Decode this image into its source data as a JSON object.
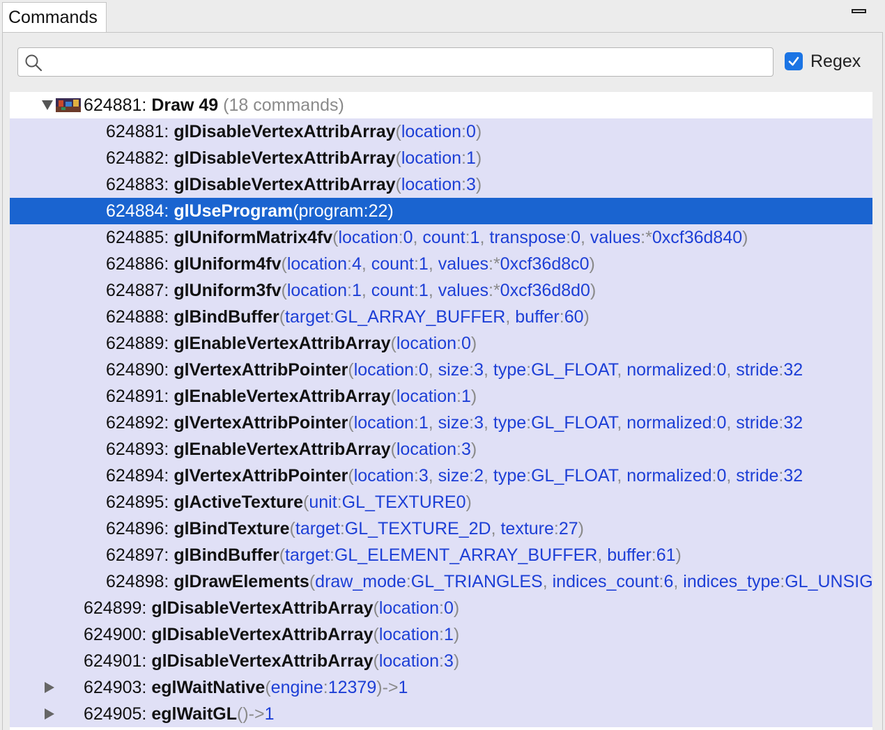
{
  "tab": {
    "title": "Commands"
  },
  "search": {
    "value": "",
    "placeholder": ""
  },
  "regex": {
    "label": "Regex",
    "checked": true
  },
  "group": {
    "id": "624881:",
    "title": "Draw 49",
    "count_text": "(18 commands)",
    "thumbnail_icon": "framebuffer-thumbnail-icon"
  },
  "commands": [
    {
      "id": "624881:",
      "fn": "glDisableVertexAttribArray",
      "params": [
        [
          "location",
          "0"
        ]
      ],
      "indent": "inner"
    },
    {
      "id": "624882:",
      "fn": "glDisableVertexAttribArray",
      "params": [
        [
          "location",
          "1"
        ]
      ],
      "indent": "inner"
    },
    {
      "id": "624883:",
      "fn": "glDisableVertexAttribArray",
      "params": [
        [
          "location",
          "3"
        ]
      ],
      "indent": "inner"
    },
    {
      "id": "624884:",
      "fn": "glUseProgram",
      "params": [
        [
          "program",
          "22"
        ]
      ],
      "indent": "inner",
      "selected": true
    },
    {
      "id": "624885:",
      "fn": "glUniformMatrix4fv",
      "params": [
        [
          "location",
          "0"
        ],
        [
          "count",
          "1"
        ],
        [
          "transpose",
          "0"
        ],
        [
          "values",
          "*0xcf36d840"
        ]
      ],
      "indent": "inner"
    },
    {
      "id": "624886:",
      "fn": "glUniform4fv",
      "params": [
        [
          "location",
          "4"
        ],
        [
          "count",
          "1"
        ],
        [
          "values",
          "*0xcf36d8c0"
        ]
      ],
      "indent": "inner"
    },
    {
      "id": "624887:",
      "fn": "glUniform3fv",
      "params": [
        [
          "location",
          "1"
        ],
        [
          "count",
          "1"
        ],
        [
          "values",
          "*0xcf36d8d0"
        ]
      ],
      "indent": "inner"
    },
    {
      "id": "624888:",
      "fn": "glBindBuffer",
      "params": [
        [
          "target",
          "GL_ARRAY_BUFFER"
        ],
        [
          "buffer",
          "60"
        ]
      ],
      "indent": "inner"
    },
    {
      "id": "624889:",
      "fn": "glEnableVertexAttribArray",
      "params": [
        [
          "location",
          "0"
        ]
      ],
      "indent": "inner"
    },
    {
      "id": "624890:",
      "fn": "glVertexAttribPointer",
      "params": [
        [
          "location",
          "0"
        ],
        [
          "size",
          "3"
        ],
        [
          "type",
          "GL_FLOAT"
        ],
        [
          "normalized",
          "0"
        ],
        [
          "stride",
          "32"
        ]
      ],
      "indent": "inner",
      "truncated": true
    },
    {
      "id": "624891:",
      "fn": "glEnableVertexAttribArray",
      "params": [
        [
          "location",
          "1"
        ]
      ],
      "indent": "inner"
    },
    {
      "id": "624892:",
      "fn": "glVertexAttribPointer",
      "params": [
        [
          "location",
          "1"
        ],
        [
          "size",
          "3"
        ],
        [
          "type",
          "GL_FLOAT"
        ],
        [
          "normalized",
          "0"
        ],
        [
          "stride",
          "32"
        ]
      ],
      "indent": "inner",
      "truncated": true
    },
    {
      "id": "624893:",
      "fn": "glEnableVertexAttribArray",
      "params": [
        [
          "location",
          "3"
        ]
      ],
      "indent": "inner"
    },
    {
      "id": "624894:",
      "fn": "glVertexAttribPointer",
      "params": [
        [
          "location",
          "3"
        ],
        [
          "size",
          "2"
        ],
        [
          "type",
          "GL_FLOAT"
        ],
        [
          "normalized",
          "0"
        ],
        [
          "stride",
          "32"
        ]
      ],
      "indent": "inner",
      "truncated": true
    },
    {
      "id": "624895:",
      "fn": "glActiveTexture",
      "params": [
        [
          "unit",
          "GL_TEXTURE0"
        ]
      ],
      "indent": "inner"
    },
    {
      "id": "624896:",
      "fn": "glBindTexture",
      "params": [
        [
          "target",
          "GL_TEXTURE_2D"
        ],
        [
          "texture",
          "27"
        ]
      ],
      "indent": "inner"
    },
    {
      "id": "624897:",
      "fn": "glBindBuffer",
      "params": [
        [
          "target",
          "GL_ELEMENT_ARRAY_BUFFER"
        ],
        [
          "buffer",
          "61"
        ]
      ],
      "indent": "inner"
    },
    {
      "id": "624898:",
      "fn": "glDrawElements",
      "params": [
        [
          "draw_mode",
          "GL_TRIANGLES"
        ],
        [
          "indices_count",
          "6"
        ],
        [
          "indices_type",
          "GL_UNSIGNED_SHORT"
        ]
      ],
      "indent": "inner",
      "truncated": true
    },
    {
      "id": "624899:",
      "fn": "glDisableVertexAttribArray",
      "params": [
        [
          "location",
          "0"
        ]
      ],
      "indent": "outer"
    },
    {
      "id": "624900:",
      "fn": "glDisableVertexAttribArray",
      "params": [
        [
          "location",
          "1"
        ]
      ],
      "indent": "outer"
    },
    {
      "id": "624901:",
      "fn": "glDisableVertexAttribArray",
      "params": [
        [
          "location",
          "3"
        ]
      ],
      "indent": "outer"
    },
    {
      "id": "624903:",
      "fn": "eglWaitNative",
      "params": [
        [
          "engine",
          "12379"
        ]
      ],
      "indent": "outer",
      "expandable": true,
      "result": "1"
    },
    {
      "id": "624905:",
      "fn": "eglWaitGL",
      "params": [],
      "indent": "outer",
      "expandable": true,
      "result": "1"
    }
  ],
  "colors": {
    "selection": "#1a64d0",
    "group_band": "#e0e0f6",
    "param": "#1d3fd6",
    "punct": "#8a8a8a",
    "checkbox": "#1b74e4"
  }
}
